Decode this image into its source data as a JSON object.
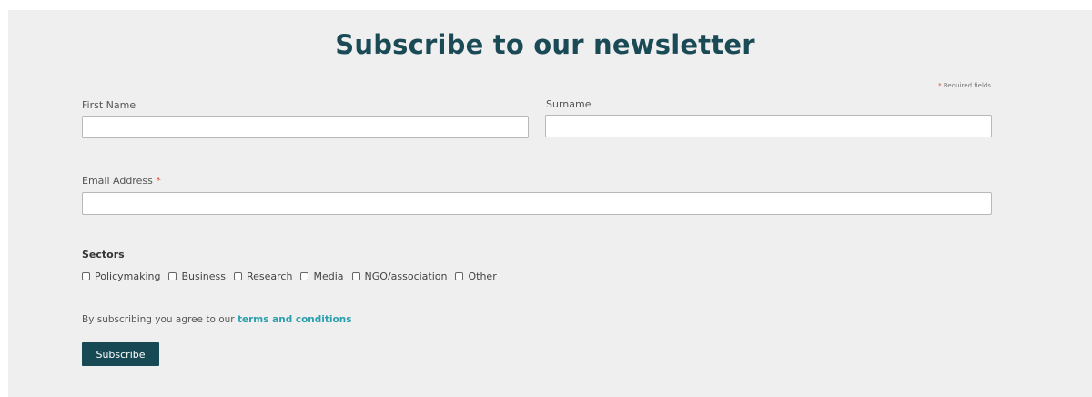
{
  "form": {
    "title": "Subscribe to our newsletter",
    "required_star": "*",
    "required_note": "Required fields",
    "first_name_label": "First Name",
    "first_name_value": "",
    "surname_label": "Surname",
    "surname_value": "",
    "email_label": "Email Address",
    "email_value": "",
    "sectors_title": "Sectors",
    "sectors": [
      "Policymaking",
      "Business",
      "Research",
      "Media",
      "NGO/association",
      "Other"
    ],
    "terms_prefix": "By subscribing you agree to our",
    "terms_link": "terms and conditions",
    "submit_label": "Subscribe"
  },
  "colors": {
    "panel_bg": "#efefef",
    "title": "#1a4a55",
    "button_bg": "#174954",
    "link": "#2a9fae",
    "required_star": "#e0452a"
  }
}
